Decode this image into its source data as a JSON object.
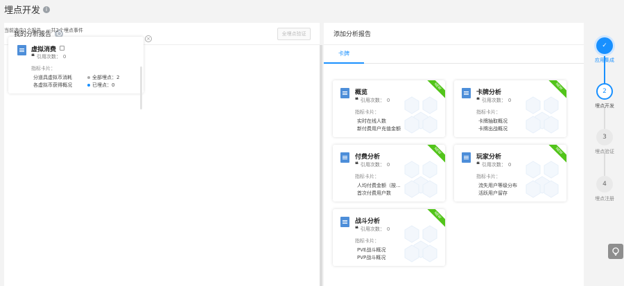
{
  "page": {
    "title": "埋点开发"
  },
  "left_panel": {
    "title": "我的分析报告",
    "verify_button": "全埋点验证",
    "summary": "当前选中1个报告，一共2个埋点事件",
    "card": {
      "title": "虚拟消费",
      "quote_label": "引用次数：",
      "quote_count": "0",
      "metrics_label": "指标卡片：",
      "metrics": [
        "分道具虚拟币消耗",
        "各虚拟币获得概况"
      ],
      "stat_all_label": "全部埋点：",
      "stat_all_value": "2",
      "stat_done_label": "已埋点：",
      "stat_done_value": "0"
    }
  },
  "right_panel": {
    "title": "添加分析报告",
    "tab": "卡牌",
    "quote_label": "引用次数：",
    "metrics_label": "指标卡片：",
    "badge": "NEW",
    "cards": [
      {
        "title": "概览",
        "quote_count": "0",
        "metrics": [
          "实时在线人数",
          "新付费用户充值金额"
        ]
      },
      {
        "title": "卡牌分析",
        "quote_count": "0",
        "metrics": [
          "卡牌抽取概况",
          "卡牌出战概况"
        ]
      },
      {
        "title": "付费分析",
        "quote_count": "0",
        "metrics": [
          "人均付费金额（按...",
          "首次付费用户数"
        ]
      },
      {
        "title": "玩家分析",
        "quote_count": "0",
        "metrics": [
          "流失用户等级分布",
          "活跃用户留存"
        ]
      },
      {
        "title": "战斗分析",
        "quote_count": "0",
        "metrics": [
          "PVE战斗概况",
          "PVP战斗概况"
        ]
      }
    ]
  },
  "stepper": {
    "steps": [
      {
        "number": "✓",
        "label": "应用集成",
        "state": "done"
      },
      {
        "number": "2",
        "label": "埋点开发",
        "state": "active"
      },
      {
        "number": "3",
        "label": "埋点验证",
        "state": "pending"
      },
      {
        "number": "4",
        "label": "埋点注册",
        "state": "pending"
      }
    ]
  },
  "colors": {
    "accent": "#1890ff",
    "badge": "#52c41a",
    "doc_icon": "#4d8ed9"
  },
  "icons": [
    "info-icon",
    "document-icon",
    "edit-icon",
    "quote-icon",
    "close-icon",
    "check-icon",
    "hexagon-decoration",
    "help-bulb-icon"
  ]
}
